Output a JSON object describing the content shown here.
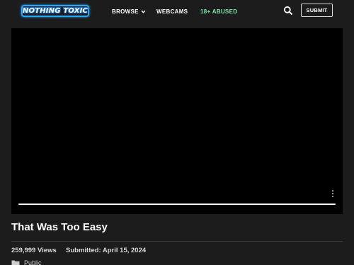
{
  "header": {
    "logo_text": "NOTHING TOXIC",
    "nav": {
      "browse": "BROWSE",
      "webcams": "WEBCAMS",
      "abused": "18+ ABUSED"
    },
    "submit_label": "SUBMIT",
    "icons": {
      "search": "search-icon",
      "browse_dropdown": "chevron-down-icon"
    }
  },
  "player": {
    "progress_fraction": 1.0,
    "menu_icon": "more-vertical-icon"
  },
  "video": {
    "title": "That Was Too Easy",
    "views": "259,999 Views",
    "submitted": "Submitted: April 15, 2024",
    "category": "Public",
    "category_icon": "folder-icon"
  },
  "colors": {
    "background": "#1c1c1c",
    "logo_accent": "#2aa8ff",
    "abused_link": "#7ee8b0"
  }
}
